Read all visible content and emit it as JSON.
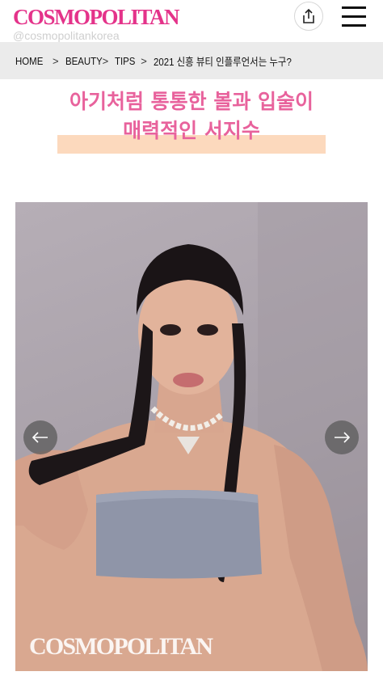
{
  "header": {
    "logo": "COSMOPOLITAN",
    "handle": "@cosmopolitankorea",
    "share_icon": "share-icon",
    "menu_icon": "hamburger-menu-icon"
  },
  "breadcrumb": {
    "items": [
      "HOME",
      "BEAUTY",
      "TIPS",
      "2021 신흥 뷰티 인플루언서는 누구?"
    ],
    "separator": ">"
  },
  "headline": {
    "line1": "아기처럼 통통한 볼과 입술이",
    "line2": "매력적인 서지수",
    "color": "#e8629c",
    "highlight_color": "#fcd9bd"
  },
  "gallery": {
    "watermark": "COSMOPOLITAN",
    "prev_icon": "arrow-left-icon",
    "next_icon": "arrow-right-icon"
  },
  "colors": {
    "brand": "#e4338a",
    "breadcrumb_bg": "#ebebeb"
  }
}
